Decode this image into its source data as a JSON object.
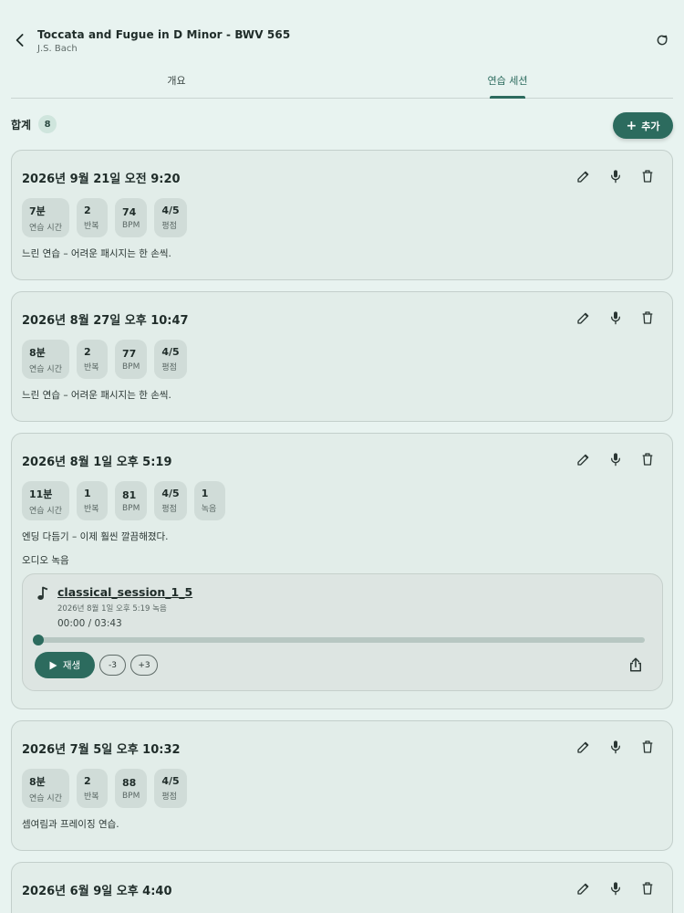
{
  "header": {
    "title": "Toccata and Fugue in D Minor - BWV 565",
    "subtitle": "J.S. Bach"
  },
  "tabs": [
    {
      "label": "개요",
      "active": false
    },
    {
      "label": "연습 세션",
      "active": true
    }
  ],
  "summary": {
    "label": "합계",
    "count": "8"
  },
  "add_button": {
    "label": "추가"
  },
  "colors": {
    "accent": "#2c6b5e",
    "background": "#e8f3f0",
    "card": "#e2ede9"
  },
  "sessions": [
    {
      "date": "2026년 9월 21일 오전 9:20",
      "stats": [
        {
          "value": "7분",
          "label": "연습 시간"
        },
        {
          "value": "2",
          "label": "반복"
        },
        {
          "value": "74",
          "label": "BPM"
        },
        {
          "value": "4/5",
          "label": "평점"
        }
      ],
      "note": "느린 연습 – 어려운 패시지는 한 손씩."
    },
    {
      "date": "2026년 8월 27일 오후 10:47",
      "stats": [
        {
          "value": "8분",
          "label": "연습 시간"
        },
        {
          "value": "2",
          "label": "반복"
        },
        {
          "value": "77",
          "label": "BPM"
        },
        {
          "value": "4/5",
          "label": "평점"
        }
      ],
      "note": "느린 연습 – 어려운 패시지는 한 손씩."
    },
    {
      "date": "2026년 8월 1일 오후 5:19",
      "stats": [
        {
          "value": "11분",
          "label": "연습 시간"
        },
        {
          "value": "1",
          "label": "반복"
        },
        {
          "value": "81",
          "label": "BPM"
        },
        {
          "value": "4/5",
          "label": "평점"
        },
        {
          "value": "1",
          "label": "녹음"
        }
      ],
      "note": "엔딩 다듬기 – 이제 훨씬 깔끔해졌다.",
      "recordings_label": "오디오 녹음",
      "recording": {
        "name": "classical_session_1_5",
        "recorded_at": "2026년 8월 1일 오후 5:19 녹음",
        "time": "00:00 / 03:43",
        "progress": 0,
        "play_label": "재생",
        "skip_back_label": "-3",
        "skip_forward_label": "+3"
      }
    },
    {
      "date": "2026년 7월 5일 오후 10:32",
      "stats": [
        {
          "value": "8분",
          "label": "연습 시간"
        },
        {
          "value": "2",
          "label": "반복"
        },
        {
          "value": "88",
          "label": "BPM"
        },
        {
          "value": "4/5",
          "label": "평점"
        }
      ],
      "note": "셈여림과 프레이징 연습."
    },
    {
      "date": "2026년 6월 9일 오후 4:40"
    }
  ],
  "icons": {
    "back": "arrow-back-icon",
    "refresh": "refresh-icon",
    "edit": "pencil-icon",
    "record": "microphone-icon",
    "delete": "trash-icon",
    "music": "music-note-icon",
    "play": "play-icon",
    "share": "share-icon"
  }
}
